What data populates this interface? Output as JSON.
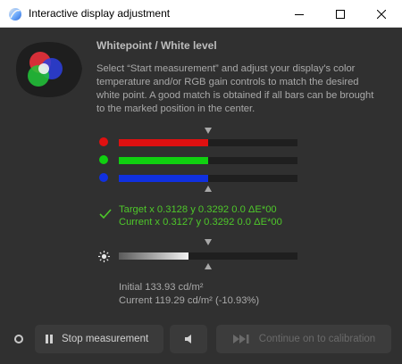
{
  "window": {
    "title": "Interactive display adjustment",
    "minimize_glyph": "—",
    "maximize_glyph": "☐",
    "close_glyph": "✕"
  },
  "logo": {
    "icon": "rgb-circles-logo"
  },
  "heading": "Whitepoint / White level",
  "description": "Select “Start measurement” and adjust your display's color temperature and/or RGB gain controls to match the desired white point. A good match is obtained if all bars can be brought to the marked position in the center.",
  "rgb_bars": [
    {
      "name": "red",
      "color": "#e01010",
      "fill_fraction": 0.5
    },
    {
      "name": "green",
      "color": "#10d010",
      "fill_fraction": 0.5
    },
    {
      "name": "blue",
      "color": "#1030e0",
      "fill_fraction": 0.5
    }
  ],
  "match_status": {
    "icon": "check-icon",
    "color": "#4ec72a",
    "target_line": "Target x 0.3128 y 0.3292 0.0 ΔE*00",
    "current_line": "Current x 0.3127 y 0.3292 0.0 ΔE*00"
  },
  "luminance_bar": {
    "icon": "sun-icon",
    "fill_fraction": 0.39
  },
  "luminance": {
    "initial_line": "Initial 133.93 cd/m²",
    "current_line": "Current 119.29 cd/m² (-10.93%)"
  },
  "footer": {
    "status_icon": "status-ring-icon",
    "stop_button": "Stop measurement",
    "sound_button_icon": "speaker-icon",
    "continue_button": "Continue on to calibration"
  }
}
